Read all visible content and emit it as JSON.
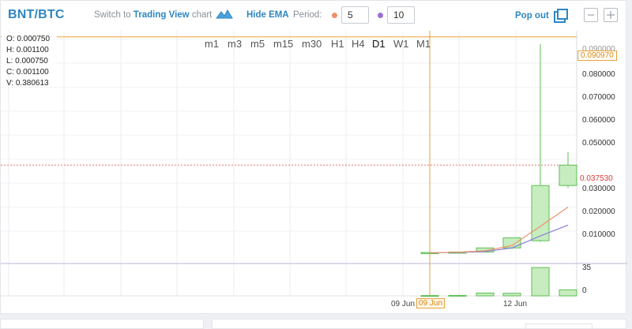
{
  "header": {
    "pair": "BNT/BTC",
    "switch_prefix": "Switch to",
    "switch_link": "Trading View",
    "switch_suffix": "chart",
    "hide_ema": "Hide EMA",
    "period_label": "Period:",
    "period1": "5",
    "period2": "10",
    "pop_out": "Pop out"
  },
  "ohlc": {
    "o": "O: 0.000750",
    "h": "H: 0.001100",
    "l": "L: 0.000750",
    "c": "C: 0.001100",
    "v": "V: 0.380613"
  },
  "timeframes": [
    "m1",
    "m3",
    "m5",
    "m15",
    "m30",
    "H1",
    "H4",
    "D1",
    "W1",
    "M1"
  ],
  "active_timeframe": "D1",
  "y_axis_labels": [
    "0.090000",
    "0.080000",
    "0.070000",
    "0.060000",
    "0.050000",
    "0.030000",
    "0.020000",
    "0.010000"
  ],
  "price_tags": {
    "high": "0.090970",
    "last": "0.037530"
  },
  "volume_labels": {
    "top": "35",
    "bottom": "0"
  },
  "x_axis_labels": {
    "date1": "09 Jun",
    "cursor_date": "09 Jun",
    "date2": "12 Jun"
  },
  "colors": {
    "accent": "#2e86c1",
    "candle_up_fill": "#c7ecc0",
    "candle_up_stroke": "#5cbf52",
    "ema_fast": "#f0906a",
    "ema_slow": "#8a7fd8",
    "crosshair": "#e8a23a",
    "last_price": "#d83a3a"
  },
  "chart_data": {
    "type": "candlestick",
    "candles": [
      {
        "open": 0.00075,
        "high": 0.0011,
        "low": 0.00075,
        "close": 0.0011,
        "volume": 0.38
      },
      {
        "open": 0.0011,
        "high": 0.0013,
        "low": 0.001,
        "close": 0.0013,
        "volume": 0.6
      },
      {
        "open": 0.0013,
        "high": 0.003,
        "low": 0.0012,
        "close": 0.003,
        "volume": 3.5
      },
      {
        "open": 0.003,
        "high": 0.0072,
        "low": 0.0025,
        "close": 0.0072,
        "volume": 3.2
      },
      {
        "open": 0.006,
        "high": 0.088,
        "low": 0.0055,
        "close": 0.029,
        "volume": 35
      },
      {
        "open": 0.029,
        "high": 0.043,
        "low": 0.028,
        "close": 0.0375,
        "volume": 7.5
      }
    ],
    "ema5": [
      0.001,
      0.0012,
      0.0018,
      0.004,
      0.012,
      0.02
    ],
    "ema10": [
      0.001,
      0.0011,
      0.0015,
      0.003,
      0.008,
      0.0125
    ],
    "ylim": [
      -0.0035,
      0.0935
    ],
    "vol_ylim": [
      0,
      38
    ],
    "high_line": 0.09097,
    "last_line": 0.03753
  }
}
